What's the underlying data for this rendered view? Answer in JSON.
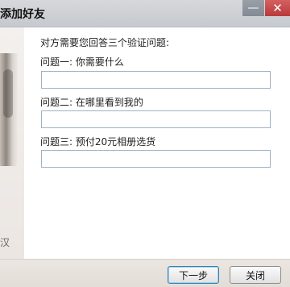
{
  "window": {
    "title": "添加好友",
    "minimize_glyph": "—",
    "close_glyph": "✕"
  },
  "side": {
    "text": "汉"
  },
  "form": {
    "instruction": "对方需要您回答三个验证问题:",
    "questions": [
      {
        "label": "问题一: 你需要什么",
        "answer": ""
      },
      {
        "label": "问题二: 在哪里看到我的",
        "answer": ""
      },
      {
        "label": "问题三: 预付20元相册选货",
        "answer": ""
      }
    ]
  },
  "footer": {
    "next_label": "下一步",
    "close_label": "关闭"
  },
  "colors": {
    "input_border": "#9fb2c6",
    "primary_button_border": "#3c7fb1"
  }
}
